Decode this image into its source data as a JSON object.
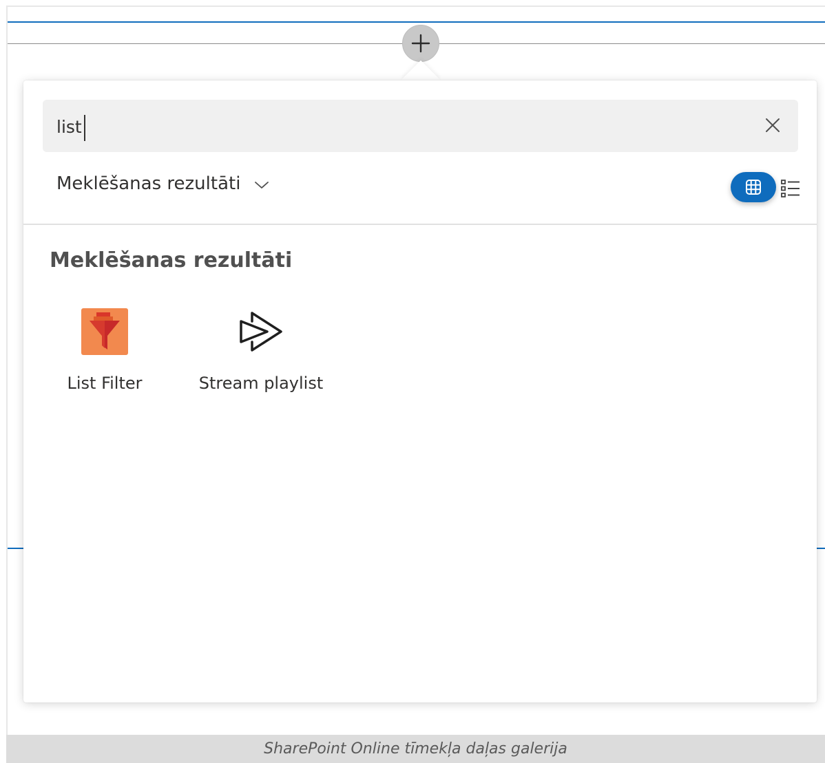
{
  "search": {
    "value": "list",
    "clear_icon": "close-icon"
  },
  "filter": {
    "label": "Meklēšanas rezultāti",
    "icon": "chevron-down-icon"
  },
  "view_toggle": {
    "grid_icon": "grid-view-icon",
    "list_icon": "list-view-icon",
    "active": "grid",
    "accent": "#0f6cbd"
  },
  "results": {
    "heading": "Meklēšanas rezultāti",
    "items": [
      {
        "label": "List Filter",
        "icon": "funnel-icon"
      },
      {
        "label": "Stream playlist",
        "icon": "stream-play-icon"
      }
    ]
  },
  "add_section": {
    "icon": "plus-icon"
  },
  "caption": "SharePoint Online tīmekļa daļas galerija"
}
